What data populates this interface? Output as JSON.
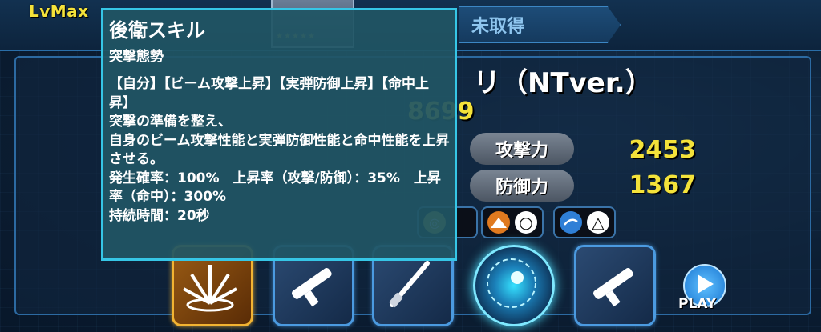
{
  "header": {
    "level_label": "LvMax",
    "acquire_tab_label": "未取得"
  },
  "unit": {
    "name": "リ（NTver.）",
    "cost": "8699",
    "stats": [
      {
        "label": "攻撃力",
        "value": "2453"
      },
      {
        "label": "防御力",
        "value": "1367"
      }
    ]
  },
  "affinity_icons": [
    {
      "icon": "mountain-terrain-icon",
      "mark": "○",
      "color": "#e07a1f"
    },
    {
      "icon": "sky-terrain-icon",
      "mark": "△",
      "color": "#2f7fd6"
    }
  ],
  "skill_slots": [
    {
      "name": "support-skill-burst-icon",
      "style": "gold"
    },
    {
      "name": "bazooka-weapon-icon",
      "style": "blue"
    },
    {
      "name": "beam-saber-weapon-icon",
      "style": "blue"
    },
    {
      "name": "funnel-attack-icon",
      "style": "glow"
    },
    {
      "name": "bazooka-weapon-icon-2",
      "style": "blue"
    }
  ],
  "play_button": {
    "label": "PLAY"
  },
  "tooltip": {
    "title": "後衛スキル",
    "subtitle": "突撃態勢",
    "body": "【自分】【ビーム攻撃上昇】【実弾防御上昇】【命中上昇】\n突撃の準備を整え、\n自身のビーム攻撃性能と実弾防御性能と命中性能を上昇させる。\n発生確率：100%　上昇率（攻撃/防御）：35%　上昇率（命中）：300%\n持続時間：20秒"
  },
  "colors": {
    "accent_yellow": "#f4e23a",
    "tooltip_border": "#36c6e6",
    "tooltip_bg": "#205564",
    "slot_border": "#4b9ae0",
    "gold_slot_border": "#f2b332"
  }
}
